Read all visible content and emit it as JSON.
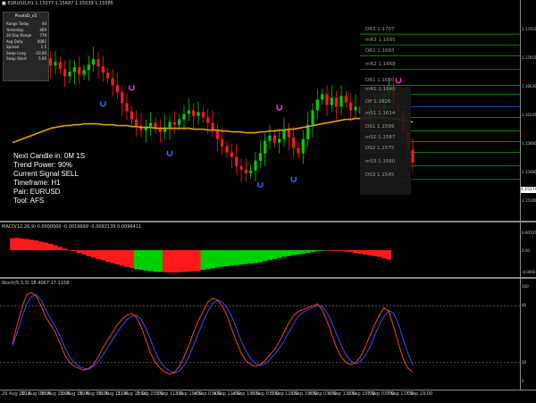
{
  "header": {
    "symbol_line": "■ EURUSD,H1  1.15077 1.15687 1.15039 1.15586",
    "macd_line": "MACD(12,26,9) 0.0000000 -0.0019699 -0.0092139 0.0096411",
    "stoch_line": "Stoch(5,3,3) 18.4067 17.1158"
  },
  "info_panel": {
    "title": "PivotsD_v5",
    "rows": [
      {
        "k": "Range Today",
        "v": "44"
      },
      {
        "k": "Yesterday",
        "v": "469"
      },
      {
        "k": "30 Day Range",
        "v": "779"
      },
      {
        "k": "Avg Daily",
        "v": "0081"
      },
      {
        "k": "Spread",
        "v": "1.5"
      },
      {
        "k": "Swap Long",
        "v": "-10.00"
      },
      {
        "k": "Swap Short",
        "v": "5.00"
      }
    ]
  },
  "overlay": {
    "next_candle": "Next Candle in: 0M 1S",
    "trend_power": "Trend Power: 90%",
    "current_signal": "Current Signal SELL",
    "timeframe": "Timeframe: H1",
    "pair": "Pair: EURUSD",
    "tool": "Tool: AFS"
  },
  "pivots": [
    {
      "label": "DR3",
      "value": "1.1707",
      "color": "#00c000"
    },
    {
      "label": "mR3",
      "value": "1.1695",
      "color": "#00c000"
    },
    {
      "label": "DR2",
      "value": "1.1683",
      "color": "#00c000"
    },
    {
      "label": "mR2",
      "value": "1.1668",
      "color": "#00c000"
    },
    {
      "label": "DR1",
      "value": "1.1650",
      "color": "#00c000"
    },
    {
      "label": "mR1",
      "value": "1.1640",
      "color": "#00c000"
    },
    {
      "label": "DP",
      "value": "1.1626",
      "color": "#2a5cff"
    },
    {
      "label": "mS1",
      "value": "1.1614",
      "color": "#00c000"
    },
    {
      "label": "DS1",
      "value": "1.1599",
      "color": "#00c000"
    },
    {
      "label": "mS2",
      "value": "1.1587",
      "color": "#00c000"
    },
    {
      "label": "DS2",
      "value": "1.1575",
      "color": "#00c000"
    },
    {
      "label": "mS3",
      "value": "1.1560",
      "color": "#00c000"
    },
    {
      "label": "DS3",
      "value": "1.1545",
      "color": "#00c000"
    }
  ],
  "price_scale": [
    "1.17410",
    "1.17015",
    "1.16630",
    "1.16245",
    "1.15860",
    "1.15480",
    "1.15100"
  ],
  "current_price": "1.15570",
  "macd_scale": [
    "0.007071",
    "0.00",
    "-0.009224"
  ],
  "stoch_scale": [
    "100",
    "80",
    "20",
    "0"
  ],
  "time_labels": [
    "29 Aug 2018",
    "30 Aug 03:00",
    "30 Aug 11:00",
    "30 Aug 19:00",
    "31 Aug 03:00",
    "31 Aug 11:00",
    "31 Aug 19:00",
    "3 Sep 03:00",
    "3 Sep 11:00",
    "3 Sep 19:00",
    "4 Sep 03:00",
    "4 Sep 11:00",
    "4 Sep 19:00",
    "5 Sep 03:00",
    "5 Sep 11:00",
    "5 Sep 19:00",
    "6 Sep 03:00",
    "6 Sep 11:00",
    "6 Sep 19:00",
    "7 Sep 03:00",
    "7 Sep 11:00",
    "7 Sep 19:00"
  ],
  "colors": {
    "bull": "#00d000",
    "bear": "#ff1a1a",
    "ma": "#e6a100",
    "stoch_main": "#ff4020",
    "stoch_signal": "#3050ff",
    "signal_up": "#ff33cc",
    "signal_down": "#1e7bff"
  },
  "chart_data": {
    "type": "candlestick",
    "closes": [
      1.1705,
      1.1712,
      1.1698,
      1.1702,
      1.169,
      1.1684,
      1.1693,
      1.168,
      1.1672,
      1.1676,
      1.1668,
      1.166,
      1.1665,
      1.167,
      1.1662,
      1.1667,
      1.1673,
      1.1679,
      1.1671,
      1.1664,
      1.1658,
      1.165,
      1.1642,
      1.163,
      1.1621,
      1.1612,
      1.1605,
      1.16,
      1.1604,
      1.1608,
      1.1602,
      1.1598,
      1.1603,
      1.1609,
      1.1606,
      1.1612,
      1.1618,
      1.1622,
      1.1616,
      1.162,
      1.1614,
      1.1608,
      1.16,
      1.159,
      1.1582,
      1.1575,
      1.157,
      1.156,
      1.1556,
      1.1552,
      1.1555,
      1.1566,
      1.1574,
      1.1588,
      1.1594,
      1.1586,
      1.159,
      1.16,
      1.1592,
      1.158,
      1.1574,
      1.159,
      1.1606,
      1.1622,
      1.1634,
      1.164,
      1.1628,
      1.1636,
      1.1626,
      1.1638,
      1.1631,
      1.1622,
      1.1626,
      1.1618,
      1.1612,
      1.1625,
      1.1628,
      1.1622,
      1.164,
      1.1646,
      1.163,
      1.162,
      1.1598,
      1.1578,
      1.1564
    ],
    "ma_values": [
      1.1586,
      1.1588,
      1.159,
      1.1592,
      1.1594,
      1.1596,
      1.1598,
      1.16,
      1.1602,
      1.1603,
      1.1604,
      1.1605,
      1.1605,
      1.1606,
      1.1606,
      1.1607,
      1.1607,
      1.1607,
      1.1607,
      1.1606,
      1.1606,
      1.1606,
      1.1605,
      1.1605,
      1.1605,
      1.1604,
      1.1604,
      1.1603,
      1.1603,
      1.1603,
      1.1602,
      1.1602,
      1.1602,
      1.1602,
      1.1602,
      1.1602,
      1.1602,
      1.1602,
      1.1601,
      1.1601,
      1.1601,
      1.16,
      1.16,
      1.16,
      1.1599,
      1.1599,
      1.1598,
      1.1598,
      1.1598,
      1.1597,
      1.1597,
      1.1597,
      1.1598,
      1.1598,
      1.1599,
      1.1599,
      1.16,
      1.16,
      1.1601,
      1.1601,
      1.1602,
      1.1603,
      1.1604,
      1.1605,
      1.1606,
      1.1607,
      1.1608,
      1.1609,
      1.161,
      1.1611,
      1.1612,
      1.1612,
      1.1613,
      1.1613,
      1.1614,
      1.1614,
      1.1614,
      1.1614,
      1.1614,
      1.1613,
      1.1613,
      1.1612,
      1.1611,
      1.161,
      1.1609
    ],
    "macd_hist": [
      0.0045,
      0.0046,
      0.0044,
      0.0042,
      0.0039,
      0.0036,
      0.0032,
      0.0028,
      0.0024,
      0.0018,
      0.0012,
      0.0006,
      0.0001,
      -0.0004,
      -0.001,
      -0.0016,
      -0.0022,
      -0.0028,
      -0.0033,
      -0.0038,
      -0.0043,
      -0.0048,
      -0.0053,
      -0.0058,
      -0.0062,
      -0.0066,
      -0.007,
      -0.0073,
      -0.0076,
      -0.0078,
      -0.008,
      -0.0081,
      -0.0082,
      -0.0083,
      -0.0083,
      -0.0082,
      -0.0081,
      -0.008,
      -0.0079,
      -0.0077,
      -0.0074,
      -0.0071,
      -0.0068,
      -0.0065,
      -0.0062,
      -0.006,
      -0.0058,
      -0.0056,
      -0.0054,
      -0.0052,
      -0.005,
      -0.0048,
      -0.0045,
      -0.0041,
      -0.0037,
      -0.0033,
      -0.0029,
      -0.0025,
      -0.0022,
      -0.0019,
      -0.0016,
      -0.0013,
      -0.001,
      -0.0007,
      -0.0004,
      -0.0002,
      -0.0001,
      -0.0001,
      -0.0002,
      -0.0003,
      -0.0005,
      -0.0007,
      -0.001,
      -0.0013,
      -0.0016,
      -0.0019,
      -0.0022,
      -0.0025,
      -0.003,
      -0.0035
    ],
    "macd_colors": [
      "red",
      "red",
      "red",
      "red",
      "red",
      "red",
      "red",
      "red",
      "red",
      "red",
      "red",
      "red",
      "red",
      "red",
      "red",
      "red",
      "red",
      "red",
      "red",
      "red",
      "red",
      "red",
      "red",
      "red",
      "red",
      "red",
      "green",
      "green",
      "green",
      "green",
      "green",
      "green",
      "red",
      "red",
      "red",
      "red",
      "red",
      "red",
      "red",
      "red",
      "green",
      "green",
      "green",
      "green",
      "green",
      "green",
      "green",
      "green",
      "green",
      "green",
      "green",
      "green",
      "green",
      "green",
      "green",
      "green",
      "green",
      "green",
      "green",
      "green",
      "green",
      "green",
      "green",
      "green",
      "green",
      "green",
      "red",
      "red",
      "red",
      "red",
      "red",
      "red",
      "red",
      "red",
      "red",
      "red",
      "red",
      "red",
      "red",
      "red"
    ],
    "stoch_main": [
      40,
      60,
      78,
      92,
      94,
      90,
      80,
      68,
      60,
      52,
      40,
      28,
      20,
      16,
      14,
      12,
      14,
      18,
      26,
      36,
      44,
      52,
      60,
      66,
      70,
      72,
      68,
      58,
      44,
      30,
      20,
      14,
      10,
      8,
      10,
      16,
      26,
      38,
      52,
      64,
      74,
      84,
      88,
      86,
      80,
      70,
      56,
      42,
      30,
      22,
      18,
      16,
      18,
      22,
      28,
      34,
      42,
      52,
      62,
      70,
      74,
      76,
      78,
      80,
      82,
      76,
      64,
      50,
      36,
      26,
      20,
      18,
      20,
      26,
      36,
      48,
      60,
      70,
      78,
      74,
      58,
      40,
      24,
      14,
      10
    ],
    "stoch_signal": [
      38,
      52,
      68,
      82,
      90,
      92,
      86,
      76,
      66,
      58,
      48,
      36,
      26,
      20,
      16,
      14,
      13,
      16,
      21,
      28,
      36,
      44,
      52,
      59,
      65,
      69,
      70,
      66,
      56,
      44,
      31,
      21,
      15,
      11,
      9,
      11,
      17,
      26,
      38,
      51,
      63,
      74,
      82,
      86,
      84,
      78,
      69,
      56,
      43,
      32,
      24,
      19,
      17,
      19,
      23,
      29,
      35,
      43,
      52,
      61,
      69,
      73,
      76,
      78,
      80,
      79,
      73,
      63,
      50,
      38,
      28,
      22,
      19,
      21,
      27,
      36,
      48,
      60,
      69,
      75,
      72,
      61,
      45,
      30,
      18
    ],
    "signals": [
      {
        "i": 4,
        "dir": "up"
      },
      {
        "i": 25,
        "dir": "up"
      },
      {
        "i": 19,
        "dir": "down"
      },
      {
        "i": 33,
        "dir": "down"
      },
      {
        "i": 52,
        "dir": "down"
      },
      {
        "i": 56,
        "dir": "up"
      },
      {
        "i": 59,
        "dir": "down"
      },
      {
        "i": 81,
        "dir": "up"
      }
    ]
  }
}
